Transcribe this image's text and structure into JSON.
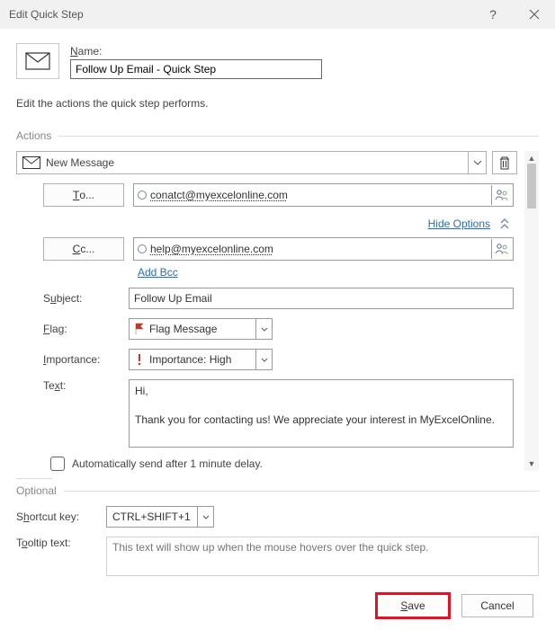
{
  "titlebar": {
    "title": "Edit Quick Step"
  },
  "name_section": {
    "label": "Name:",
    "value": "Follow Up Email - Quick Step"
  },
  "description": "Edit the actions the quick step performs.",
  "actions_header": "Actions",
  "action": {
    "name": "New Message"
  },
  "form": {
    "to_button": "To...",
    "to_value": "conatct@myexcelonline.com",
    "hide_options": "Hide Options",
    "cc_button": "Cc...",
    "cc_value": "help@myexcelonline.com",
    "add_bcc": "Add Bcc",
    "subject_label": "Subject:",
    "subject_value": "Follow Up Email",
    "flag_label": "Flag:",
    "flag_value": "Flag Message",
    "importance_label": "Importance:",
    "importance_value": "Importance: High",
    "text_label": "Text:",
    "body": "Hi,\n\nThank you for contacting us! We appreciate your interest in MyExcelOnline.",
    "auto_send": "Automatically send after 1 minute delay."
  },
  "optional": {
    "header": "Optional",
    "shortcut_label": "Shortcut key:",
    "shortcut_value": "CTRL+SHIFT+1",
    "tooltip_label": "Tooltip text:",
    "tooltip_placeholder": "This text will show up when the mouse hovers over the quick step."
  },
  "footer": {
    "save": "Save",
    "cancel": "Cancel"
  }
}
